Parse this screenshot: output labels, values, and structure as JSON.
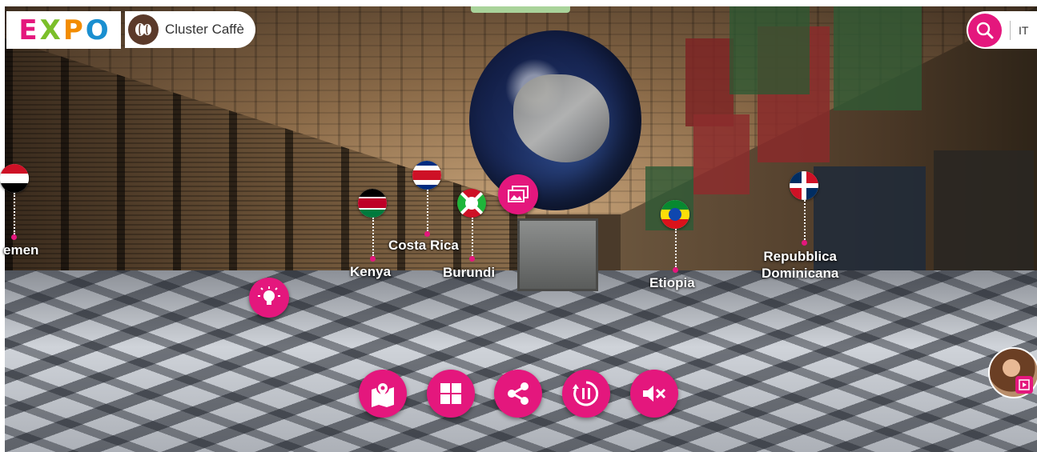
{
  "header": {
    "logo_letters": [
      "E",
      "X",
      "P",
      "O"
    ],
    "logo_colors": [
      "#e4177d",
      "#7bbf2a",
      "#f28c00",
      "#1a8fd0"
    ],
    "logo_text": "EXPO",
    "cluster_label": "Cluster Caffè",
    "cluster_icon": "coffee-beans-icon",
    "language": "IT",
    "search_icon": "search-icon"
  },
  "hotspots": [
    {
      "name": "Yemen",
      "label": "emen"
    },
    {
      "name": "Kenya",
      "label": "Kenya"
    },
    {
      "name": "Costa Rica",
      "label": "Costa Rica"
    },
    {
      "name": "Burundi",
      "label": "Burundi"
    },
    {
      "name": "Etiopia",
      "label": "Etiopia"
    },
    {
      "name": "Repubblica Dominicana",
      "label": "Repubblica\nDominicana"
    }
  ],
  "scene_buttons": {
    "gallery_icon": "gallery-icon",
    "info_icon": "lightbulb-icon"
  },
  "controls": [
    {
      "id": "map",
      "icon": "map-pin-icon"
    },
    {
      "id": "grid",
      "icon": "grid-icon"
    },
    {
      "id": "share",
      "icon": "share-icon"
    },
    {
      "id": "pause",
      "icon": "pause-rotation-icon"
    },
    {
      "id": "mute",
      "icon": "mute-icon"
    }
  ],
  "guide": {
    "icon": "play-icon"
  },
  "accent_color": "#e4177d"
}
